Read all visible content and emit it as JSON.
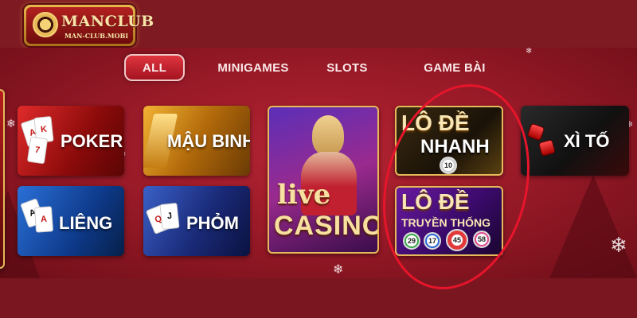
{
  "brand": {
    "name": "MANCLUB",
    "site": "MAN-CLUB.MOBI"
  },
  "tabs": [
    {
      "label": "ALL",
      "active": true
    },
    {
      "label": "MINIGAMES",
      "active": false
    },
    {
      "label": "SLOTS",
      "active": false
    },
    {
      "label": "GAME BÀI",
      "active": false
    }
  ],
  "games": {
    "poker": "POKER",
    "mau_binh": "MẬU BINH",
    "lieng": "LIÊNG",
    "phom": "PHỎM",
    "live_casino": {
      "live": "live",
      "casino": "CASINO"
    },
    "lo_de_nhanh": {
      "title": "LÔ ĐỀ",
      "sub": "NHANH",
      "ball": "10"
    },
    "lo_de_truyen_thong": {
      "title": "LÔ ĐỀ",
      "sub": "TRUYỀN THỐNG",
      "balls": [
        "29",
        "17",
        "45",
        "58"
      ]
    },
    "xi_to": "XÌ TỐ"
  },
  "colors": {
    "background": "#7a1620",
    "tab_active": "#c8222f",
    "highlight_ring": "#e6152b",
    "gold_text": "#f7e0a0"
  },
  "icons": [
    "snowflake-icon",
    "playing-card-icon",
    "dice-icon",
    "lottery-ball-icon",
    "logo-chip-icon"
  ]
}
